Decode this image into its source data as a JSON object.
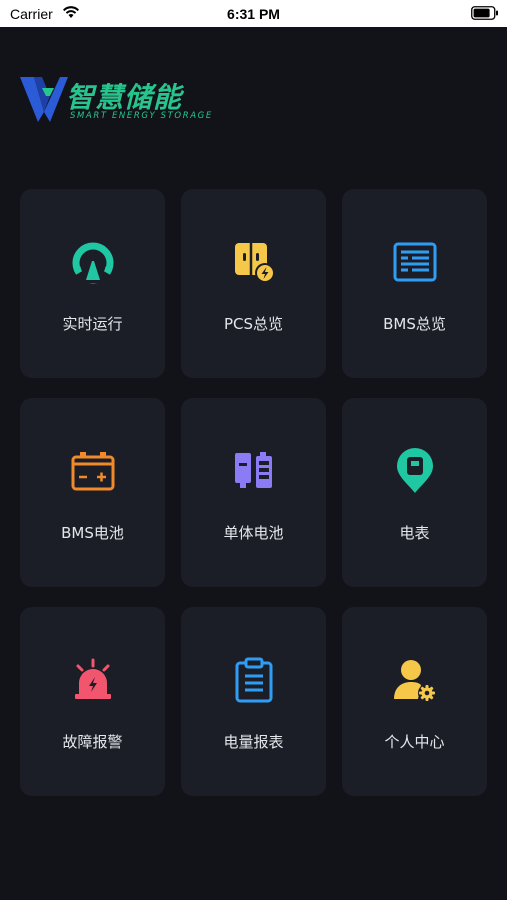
{
  "status_bar": {
    "carrier": "Carrier",
    "time": "6:31 PM"
  },
  "logo": {
    "title": "智慧储能",
    "subtitle": "SMART ENERGY STORAGE",
    "color": "#27c58d"
  },
  "menu": [
    {
      "label": "实时运行",
      "icon": "gauge-icon",
      "color": "#1fc7a3"
    },
    {
      "label": "PCS总览",
      "icon": "pcs-icon",
      "color": "#f5c84a"
    },
    {
      "label": "BMS总览",
      "icon": "list-panel-icon",
      "color": "#2f9df4"
    },
    {
      "label": "BMS电池",
      "icon": "battery-icon",
      "color": "#f08a2a"
    },
    {
      "label": "单体电池",
      "icon": "cell-battery-icon",
      "color": "#8b7cf6"
    },
    {
      "label": "电表",
      "icon": "meter-pin-icon",
      "color": "#1fc7a3"
    },
    {
      "label": "故障报警",
      "icon": "alarm-icon",
      "color": "#f2566e"
    },
    {
      "label": "电量报表",
      "icon": "clipboard-icon",
      "color": "#2f9df4"
    },
    {
      "label": "个人中心",
      "icon": "user-settings-icon",
      "color": "#f5c84a"
    }
  ]
}
